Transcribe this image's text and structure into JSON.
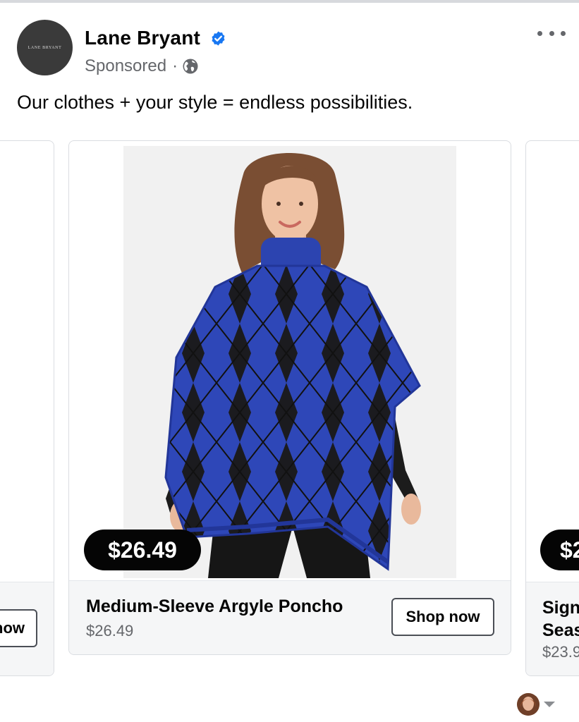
{
  "post": {
    "page_name": "Lane Bryant",
    "avatar_text": "LANE BRYANT",
    "sponsored": "Sponsored",
    "separator": "·",
    "caption": "Our clothes + your style = endless possibilities."
  },
  "carousel": {
    "left_card": {
      "cta_partial": "now"
    },
    "main_card": {
      "price_badge": "$26.49",
      "title": "Medium-Sleeve Argyle Poncho",
      "price": "$26.49",
      "cta": "Shop now"
    },
    "right_card": {
      "price_badge_partial": "$2",
      "title_line1": "Sign",
      "title_line2": "Seas",
      "price_partial": "$23.9"
    }
  },
  "colors": {
    "verified_blue": "#1877f2",
    "text_primary": "#050505",
    "text_secondary": "#65676b",
    "footer_bg": "#f5f6f7",
    "poncho_blue": "#2e47b8"
  },
  "icons": [
    "verified-badge-icon",
    "globe-icon",
    "more-options-icon",
    "caret-down-icon"
  ]
}
